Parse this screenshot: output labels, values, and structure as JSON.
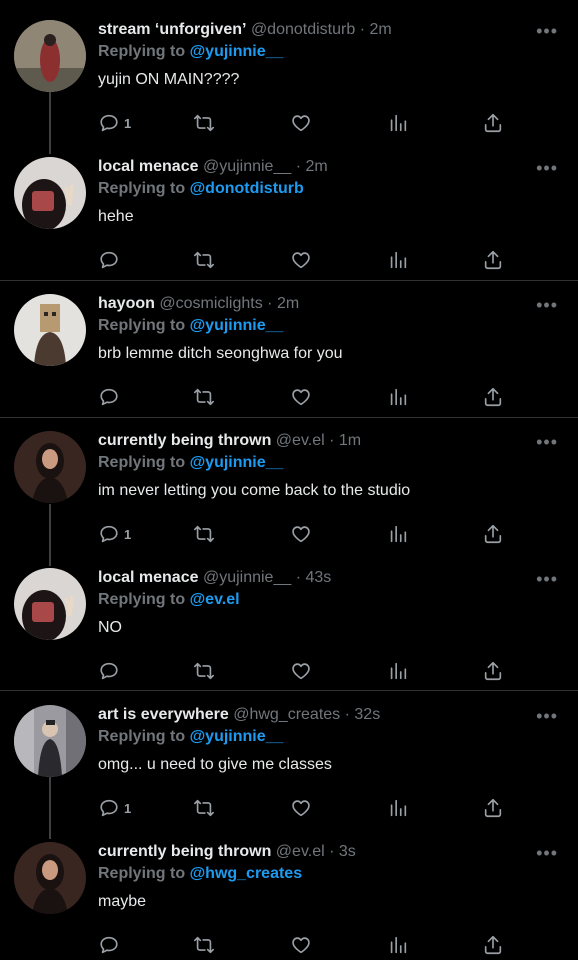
{
  "tweets": [
    {
      "name": "stream ‘unforgiven’",
      "handle": "@donotdisturb",
      "time": "2m",
      "replying_prefix": "Replying to",
      "replying_to": "@yujinnie__",
      "text": "yujin ON MAIN????",
      "reply_count": "1",
      "avatar_color": "#7a3a3a"
    },
    {
      "name": "local menace",
      "handle": "@yujinnie__",
      "time": "2m",
      "replying_prefix": "Replying to",
      "replying_to": "@donotdisturb",
      "text": "hehe",
      "reply_count": "",
      "avatar_color": "#3a3535"
    },
    {
      "name": "hayoon",
      "handle": "@cosmiclights",
      "time": "2m",
      "replying_prefix": "Replying to",
      "replying_to": "@yujinnie__",
      "text": "brb lemme ditch seonghwa for you",
      "reply_count": "",
      "avatar_color": "#b49a7a"
    },
    {
      "name": "currently being thrown",
      "handle": "@ev.el",
      "time": "1m",
      "replying_prefix": "Replying to",
      "replying_to": "@yujinnie__",
      "text": "im never letting you come back to the studio",
      "reply_count": "1",
      "avatar_color": "#5a3a30"
    },
    {
      "name": "local menace",
      "handle": "@yujinnie__",
      "time": "43s",
      "replying_prefix": "Replying to",
      "replying_to": "@ev.el",
      "text": "NO",
      "reply_count": "",
      "avatar_color": "#3a3535"
    },
    {
      "name": "art is everywhere",
      "handle": "@hwg_creates",
      "time": "32s",
      "replying_prefix": "Replying to",
      "replying_to": "@yujinnie__",
      "text": "omg... u need to give me classes",
      "reply_count": "1",
      "avatar_color": "#8a8a90"
    },
    {
      "name": "currently being thrown",
      "handle": "@ev.el",
      "time": "3s",
      "replying_prefix": "Replying to",
      "replying_to": "@hwg_creates",
      "text": "maybe",
      "reply_count": "",
      "avatar_color": "#5a3a30"
    }
  ],
  "separator": "·",
  "more_label": "•••",
  "colors": {
    "accent": "#1d9bf0",
    "muted": "#71767b",
    "background": "#000000"
  }
}
